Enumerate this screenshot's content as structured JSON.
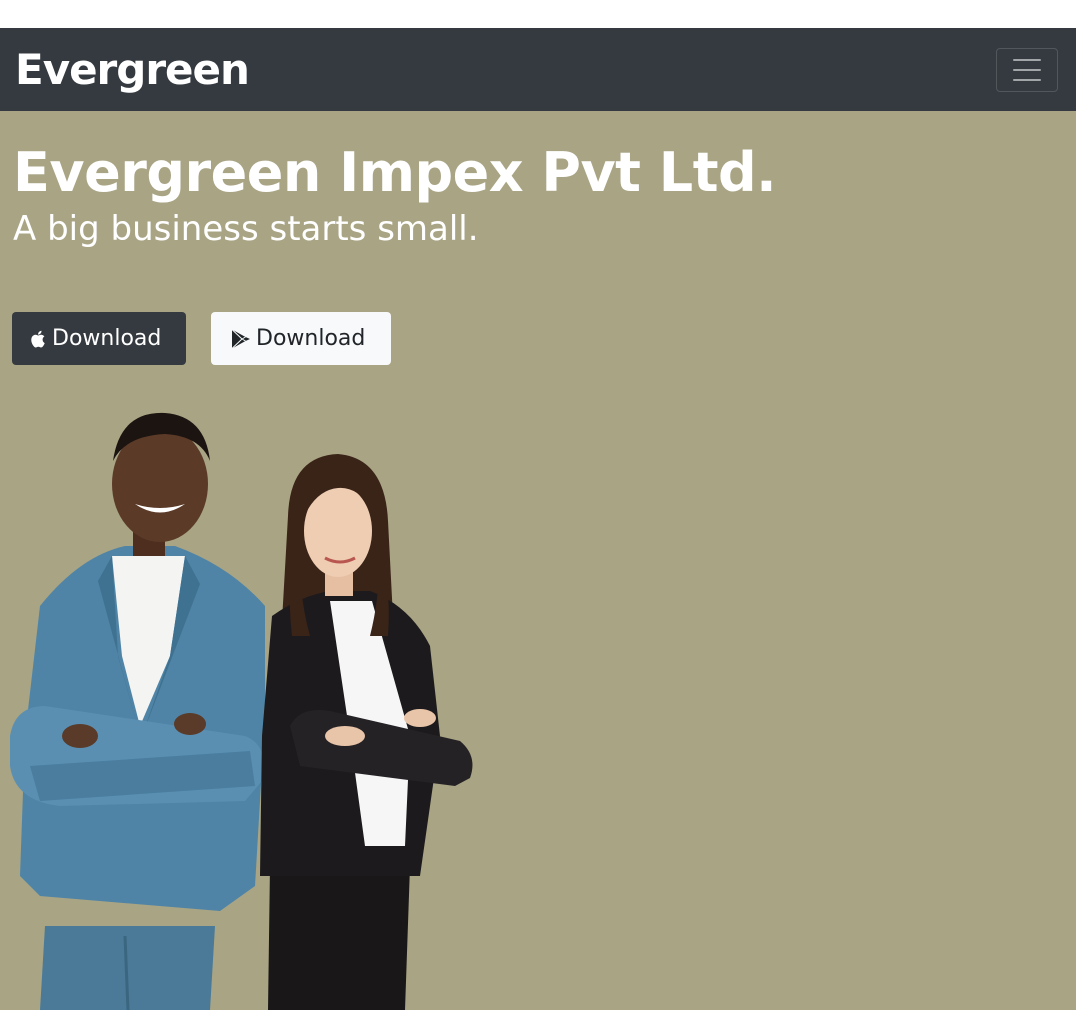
{
  "navbar": {
    "brand": "Evergreen",
    "toggler_icon": "hamburger-menu-icon"
  },
  "hero": {
    "title": "Evergreen Impex Pvt Ltd.",
    "subtitle": "A big business starts small.",
    "background_color": "#a8a484",
    "buttons": [
      {
        "label": "Download",
        "icon": "apple-icon",
        "style": "dark"
      },
      {
        "label": "Download",
        "icon": "google-play-icon",
        "style": "light"
      }
    ],
    "image": "two-business-people-photo"
  },
  "colors": {
    "navbar_bg": "#343a40",
    "hero_bg": "#a8a484",
    "dark_button": "#343a40",
    "light_button": "#f8f9fa"
  }
}
